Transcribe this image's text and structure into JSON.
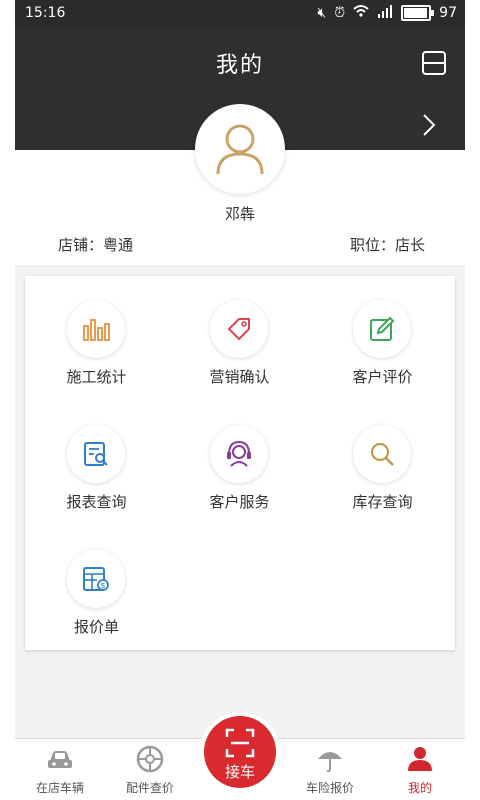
{
  "status": {
    "time": "15:16",
    "battery": "97",
    "battery_level": 0.97
  },
  "header": {
    "title": "我的"
  },
  "profile": {
    "name": "邓犇",
    "store": "店铺：粤通",
    "position": "职位：店长"
  },
  "menu": [
    {
      "label": "施工统计",
      "icon": "bar-chart-icon",
      "color": "#e8913a"
    },
    {
      "label": "营销确认",
      "icon": "tag-icon",
      "color": "#e0434e"
    },
    {
      "label": "客户评价",
      "icon": "edit-icon",
      "color": "#3aa65a"
    },
    {
      "label": "报表查询",
      "icon": "report-search-icon",
      "color": "#2f7fc9"
    },
    {
      "label": "客户服务",
      "icon": "headset-icon",
      "color": "#8a3c9c"
    },
    {
      "label": "库存查询",
      "icon": "search-icon",
      "color": "#c09a4a"
    },
    {
      "label": "报价单",
      "icon": "quote-sheet-icon",
      "color": "#2f7fc9"
    }
  ],
  "tabs": [
    {
      "label": "在店车辆",
      "icon": "car-icon"
    },
    {
      "label": "配件查价",
      "icon": "wheel-icon"
    },
    {
      "label": "车险报价",
      "icon": "umbrella-icon"
    },
    {
      "label": "我的",
      "icon": "user-icon",
      "active": true
    }
  ],
  "fab": {
    "label": "接车"
  },
  "colors": {
    "accent": "#d92b2f",
    "header": "#2f2f2f"
  }
}
